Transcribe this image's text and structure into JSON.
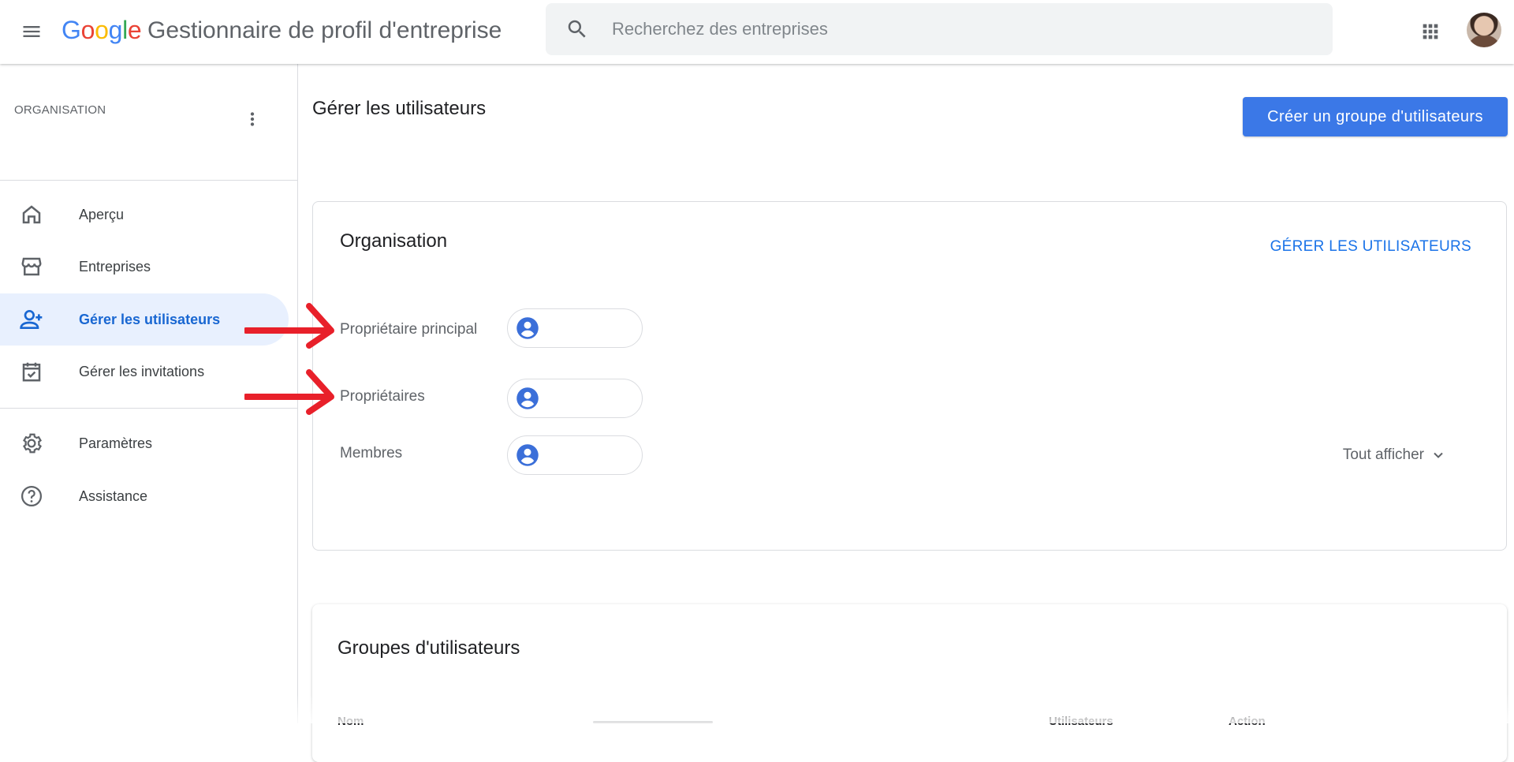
{
  "header": {
    "logo": {
      "g1": "G",
      "o1": "o",
      "o2": "o",
      "g2": "g",
      "l": "l",
      "e": "e"
    },
    "app_title": "Gestionnaire de profil d'entreprise",
    "search_placeholder": "Recherchez des entreprises"
  },
  "sidebar": {
    "org_label": "ORGANISATION",
    "items": [
      {
        "label": "Aperçu",
        "icon": "home-icon"
      },
      {
        "label": "Entreprises",
        "icon": "storefront-icon"
      },
      {
        "label": "Gérer les utilisateurs",
        "icon": "person-add-icon",
        "active": true
      },
      {
        "label": "Gérer les invitations",
        "icon": "event-available-icon"
      },
      {
        "label": "Paramètres",
        "icon": "settings-icon"
      },
      {
        "label": "Assistance",
        "icon": "help-icon"
      }
    ]
  },
  "main": {
    "page_title": "Gérer les utilisateurs",
    "create_group_button": "Créer un groupe d'utilisateurs",
    "org_card": {
      "title": "Organisation",
      "manage_link": "GÉRER LES UTILISATEURS",
      "rows": [
        {
          "label": "Propriétaire principal"
        },
        {
          "label": "Propriétaires"
        },
        {
          "label": "Membres"
        }
      ],
      "show_all": "Tout afficher"
    },
    "groups_card": {
      "title": "Groupes d'utilisateurs",
      "columns": [
        "Nom",
        "Utilisateurs",
        "Action"
      ]
    }
  },
  "colors": {
    "accent_blue": "#1a73e8",
    "button_blue": "#3b78e7",
    "annotation_red": "#e8202a",
    "active_nav_bg": "#e8f0fe"
  }
}
